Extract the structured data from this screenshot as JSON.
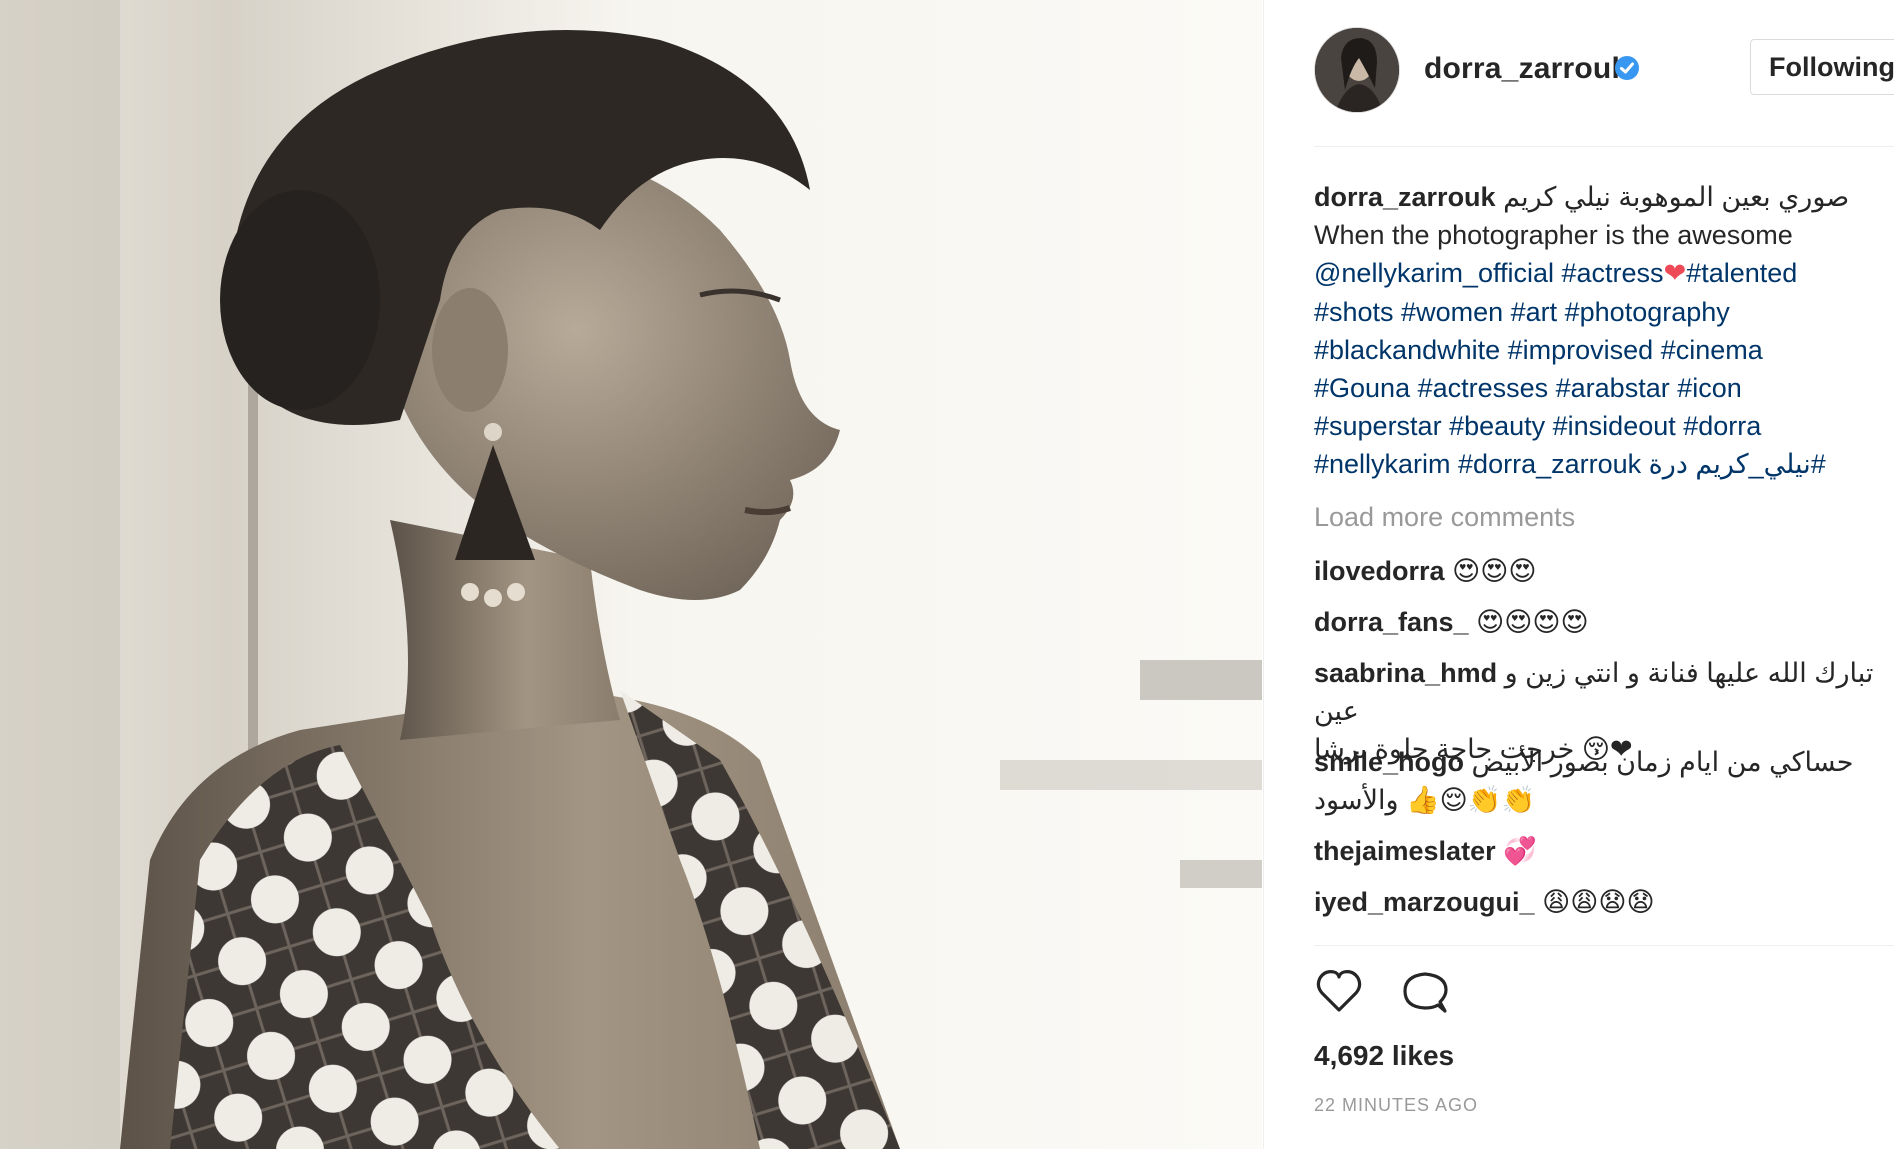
{
  "post": {
    "username": "dorra_zarrouk",
    "follow_button": "Following",
    "verified_icon": "verified-badge-icon",
    "accent_color": "#3897f0",
    "caption": {
      "line1_rtl": "صوري بعين الموهوبة نيلي كريم",
      "line2": "When the photographer is the awesome",
      "line3_mention": "@nellykarim_official",
      "line3_tag": "#actress",
      "line3_tag2": "#talented",
      "line4": "#shots #women #art #photography",
      "line5": "#blackandwhite #improvised #cinema",
      "line6": "#Gouna #actresses #arabstar #icon",
      "line7": "#superstar #beauty #insideout #dorra",
      "line8_tags": "#nellykarim #dorra_zarrouk",
      "line8_rtl": "#نيلي_كريم درة"
    },
    "load_more": "Load more comments",
    "comments": [
      {
        "user": "ilovedorra",
        "text": "😍😍😍"
      },
      {
        "user": "dorra_fans_",
        "text": "😍😍😍😍"
      },
      {
        "user": "saabrina_hmd",
        "text": "تبارك الله عليها فنانة و انتي زين و عين",
        "text2": "خرجت حاجة حلوة برشا",
        "emoji2": "😚❤"
      },
      {
        "user": "smile_hogo",
        "text": "حساكي من ايام زمان بصور الأبيض",
        "text2": "والأسود",
        "emoji2": "👍😌👏👏"
      },
      {
        "user": "thejaimeslater",
        "text": "💞"
      },
      {
        "user": "iyed_marzougui_",
        "text": "😩😩😧😧"
      }
    ],
    "likes": "4,692 likes",
    "timestamp": "22 MINUTES AGO",
    "icons": {
      "like": "heart-outline-icon",
      "comment": "speech-bubble-icon"
    }
  }
}
